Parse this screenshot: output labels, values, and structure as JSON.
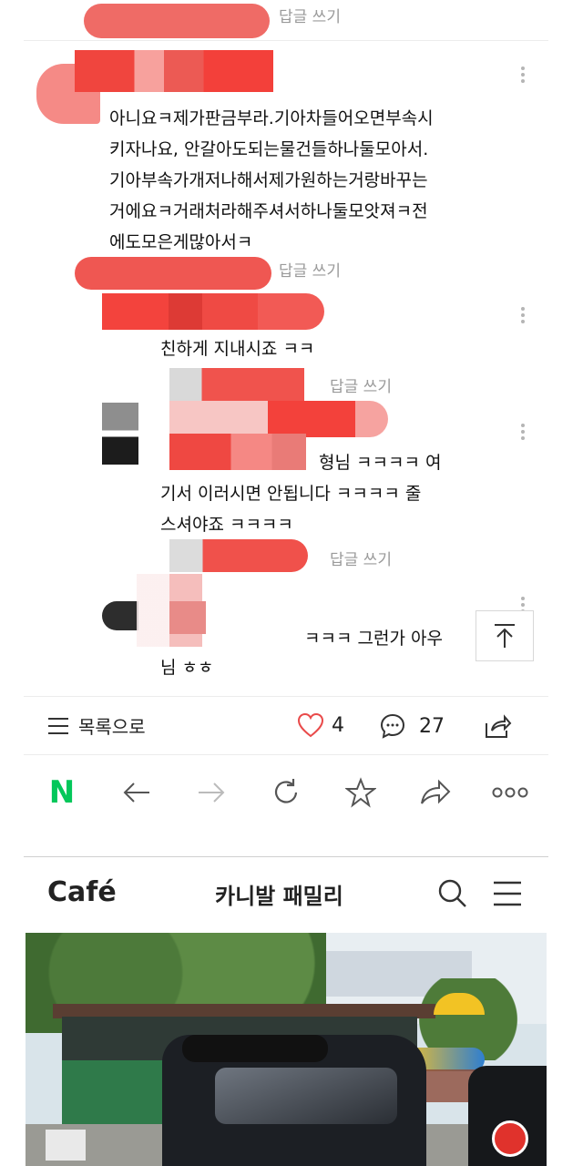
{
  "comments": [
    {
      "reply_label": "답글 쓰기",
      "text": "아니요ㅋ제가판금부라.기아차들어오면부속시\n키자나요, 안갈아도되는물건들하나둘모아서.\n기아부속가개저나해서제가원하는거랑바꾸는\n거에요ㅋ거래처라해주셔서하나둘모앗져ㅋ전\n에도모은게많아서ㅋ"
    },
    {
      "reply_label": "답글 쓰기",
      "text": "친하게 지내시죠 ㅋㅋ"
    },
    {
      "reply_label": "답글 쓰기",
      "text_head": "형님 ㅋㅋㅋㅋ 여",
      "text": "기서 이러시면 안됩니다 ㅋㅋㅋㅋ 줄\n스셔야죠 ㅋㅋㅋㅋ"
    },
    {
      "reply_label": "답글 쓰기",
      "text_head": "ㅋㅋㅋ 그런가 아우",
      "text": "님 ㅎㅎ"
    }
  ],
  "bottom_bar": {
    "list_label": "목록으로",
    "like_count": "4",
    "comment_count": "27"
  },
  "browser_nav": {
    "logo": "N"
  },
  "cafe_header": {
    "logo": "Café",
    "title": "카니발 패밀리"
  },
  "colors": {
    "redact_red": "#ea3b35",
    "naver_green": "#03c75a"
  }
}
